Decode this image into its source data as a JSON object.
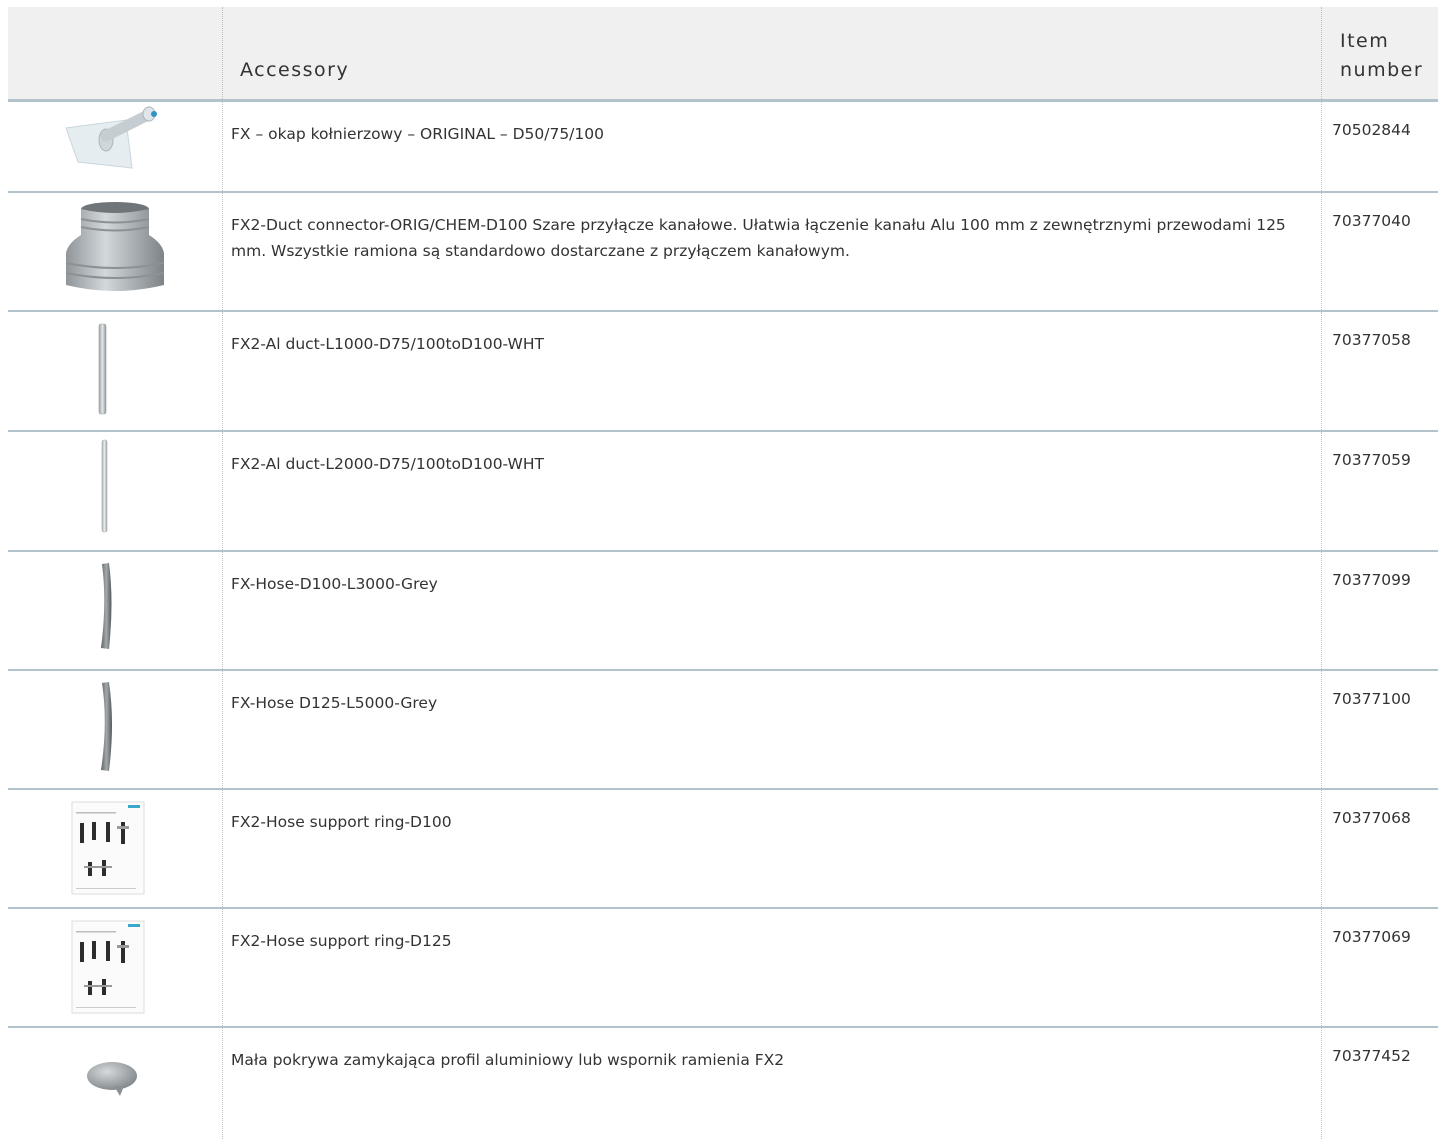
{
  "header": {
    "accessory": "Accessory",
    "item_number": "Item\nnumber"
  },
  "rows": [
    {
      "description": "FX – okap kołnierzowy – ORIGINAL – D50/75/100",
      "item_number": "70502844",
      "icon": "flange-hood-icon"
    },
    {
      "description": "FX2-Duct connector-ORIG/CHEM-D100 Szare przyłącze kanałowe. Ułatwia łączenie kanału Alu 100 mm z zewnętrznymi przewodami 125 mm. Wszystkie ramiona są standardowo dostarczane z przyłączem kanałowym.",
      "item_number": "70377040",
      "icon": "duct-connector-icon"
    },
    {
      "description": "FX2-Al duct-L1000-D75/100toD100-WHT",
      "item_number": "70377058",
      "icon": "alu-duct-1000-icon"
    },
    {
      "description": "FX2-Al duct-L2000-D75/100toD100-WHT",
      "item_number": "70377059",
      "icon": "alu-duct-2000-icon"
    },
    {
      "description": "FX-Hose-D100-L3000-Grey",
      "item_number": "70377099",
      "icon": "hose-d100-icon"
    },
    {
      "description": "FX-Hose D125-L5000-Grey",
      "item_number": "70377100",
      "icon": "hose-d125-icon"
    },
    {
      "description": "FX2-Hose support ring-D100",
      "item_number": "70377068",
      "icon": "support-ring-document-icon"
    },
    {
      "description": "FX2-Hose support ring-D125",
      "item_number": "70377069",
      "icon": "support-ring-document-icon"
    },
    {
      "description": "Mała pokrywa zamykająca profil aluminiowy lub wspornik ramienia FX2",
      "item_number": "70377452",
      "icon": "cover-cap-icon"
    }
  ]
}
